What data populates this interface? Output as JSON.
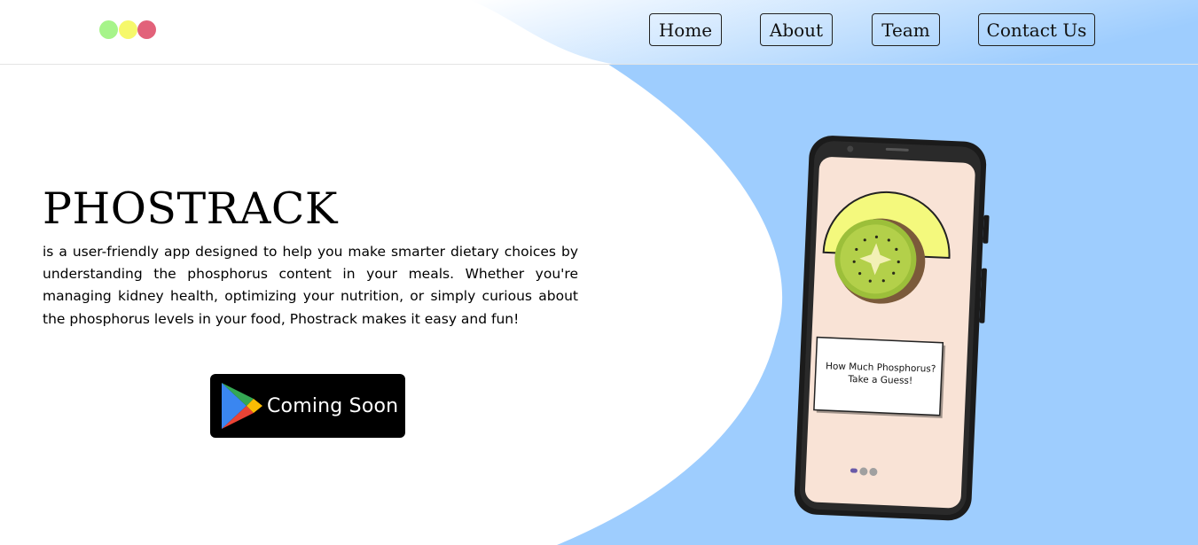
{
  "colors": {
    "accent_blue": "#9ecdfe",
    "dot_green": "#a6f48a",
    "dot_yellow": "#f6f86b",
    "dot_red": "#e2627a",
    "phone_screen": "#f9e3d6",
    "button_black": "#000000"
  },
  "header": {
    "nav": [
      {
        "label": "Home"
      },
      {
        "label": "About"
      },
      {
        "label": "Team"
      },
      {
        "label": "Contact Us"
      }
    ]
  },
  "hero": {
    "title": "PHOSTRACK",
    "description": "is a user-friendly app designed to help you make smarter dietary choices by understanding the phosphorus content in your meals. Whether you're managing kidney health, optimizing your nutrition, or simply curious about the phosphorus levels in your food, Phostrack makes it easy and fun!",
    "store_button": {
      "icon": "google-play-icon",
      "label": "Coming Soon"
    }
  },
  "phone": {
    "illustration": "kiwi-icon",
    "card_line1": "How Much Phosphorus?",
    "card_line2": "Take a Guess!",
    "carousel_pages": 3,
    "carousel_active": 1
  }
}
